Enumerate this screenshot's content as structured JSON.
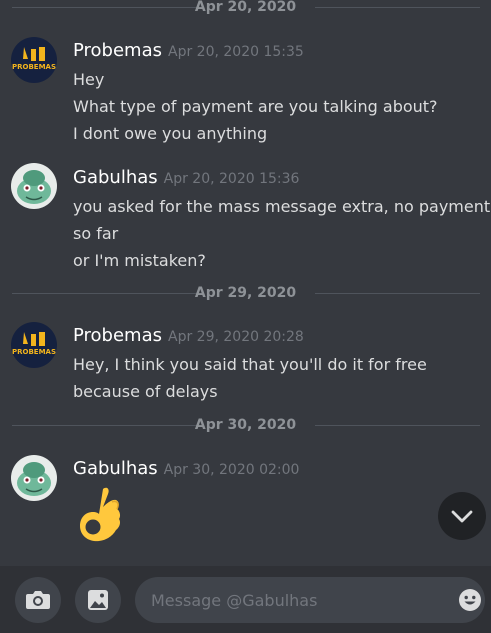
{
  "dividers": [
    "Apr 20, 2020",
    "Apr 29, 2020",
    "Apr 30, 2020"
  ],
  "messages": [
    {
      "author": "Probemas",
      "timestamp": "Apr 20, 2020 15:35",
      "lines": [
        "Hey",
        "What type of payment are you talking about?",
        "I dont owe you anything"
      ],
      "avatar_text": "PROBEMAS"
    },
    {
      "author": "Gabulhas",
      "timestamp": "Apr 20, 2020 15:36",
      "lines": [
        "you asked for the mass message extra, no payment",
        "so far",
        "or I'm mistaken?"
      ]
    },
    {
      "author": "Probemas",
      "timestamp": "Apr 29, 2020 20:28",
      "lines": [
        "Hey, I think you said that you'll do it for free",
        "because of delays"
      ],
      "avatar_text": "PROBEMAS"
    },
    {
      "author": "Gabulhas",
      "timestamp": "Apr 30, 2020 02:00",
      "emoji": "ok-hand-emoji"
    }
  ],
  "composer": {
    "placeholder": "Message @Gabulhas"
  },
  "icons": {
    "camera": "camera-icon",
    "gallery": "image-icon",
    "emoji": "smiley-icon",
    "scroll": "chevron-down-icon"
  },
  "colors": {
    "background": "#36393f",
    "input": "#40444b",
    "bar": "#2f3136",
    "muted": "#72767d"
  }
}
